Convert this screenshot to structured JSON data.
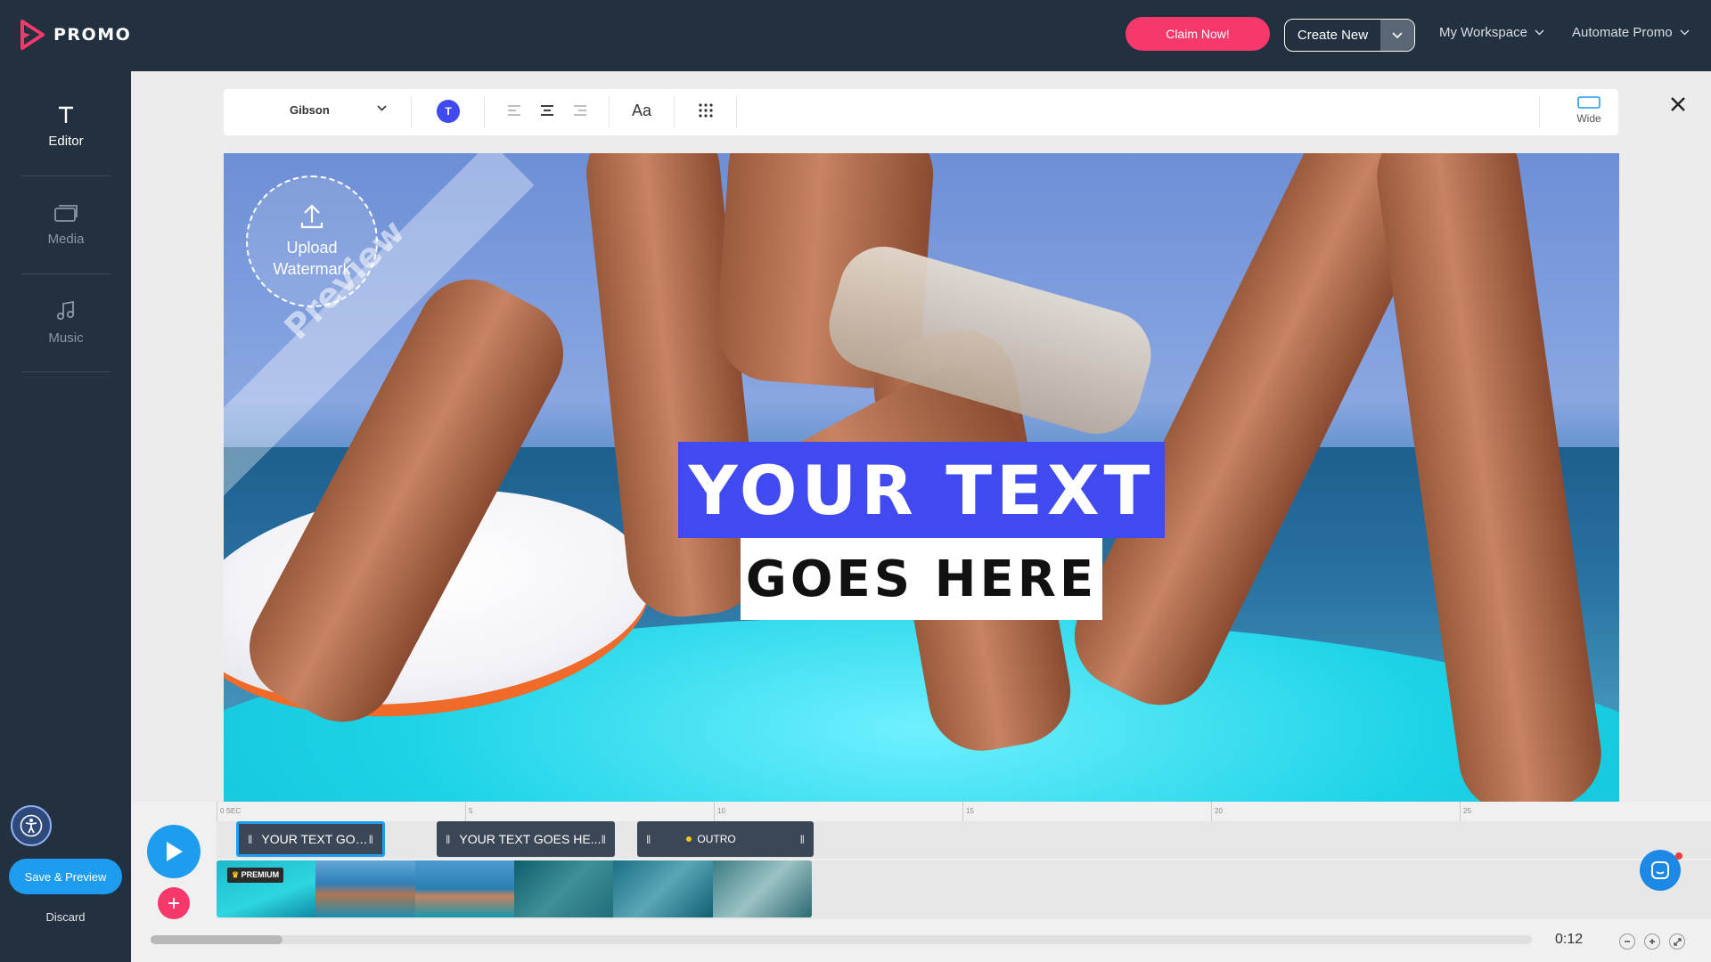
{
  "app": {
    "logo_text": "PROMO"
  },
  "header": {
    "claim_label": "Claim Now!",
    "create_label": "Create New",
    "workspace_label": "My Workspace",
    "automate_label": "Automate Promo"
  },
  "sidebar": {
    "items": [
      {
        "label": "Editor",
        "icon": "text-t-icon",
        "active": true
      },
      {
        "label": "Media",
        "icon": "media-icon",
        "active": false
      },
      {
        "label": "Music",
        "icon": "music-note-icon",
        "active": false
      }
    ],
    "save_label": "Save & Preview",
    "discard_label": "Discard"
  },
  "toolbar": {
    "font_name": "Gibson",
    "color_badge": "T",
    "case_label": "Aa",
    "format_label": "Wide"
  },
  "canvas": {
    "watermark_label_1": "Upload",
    "watermark_label_2": "Watermark",
    "preview_label": "Preview",
    "title_line_1": "YOUR TEXT",
    "title_line_2": "GOES HERE"
  },
  "timeline": {
    "ruler": [
      "0 SEC",
      "5",
      "10",
      "15",
      "20",
      "25"
    ],
    "clips": [
      {
        "label": "YOUR TEXT GOES HE..."
      },
      {
        "label": "YOUR TEXT GOES HE..."
      },
      {
        "label": "OUTRO"
      }
    ],
    "premium_label": "PREMIUM",
    "time": "0:12"
  },
  "colors": {
    "accent": "#1e9cef",
    "brand_pink": "#f6386a",
    "header_bg": "#233040",
    "title_blue": "#4149f0"
  }
}
